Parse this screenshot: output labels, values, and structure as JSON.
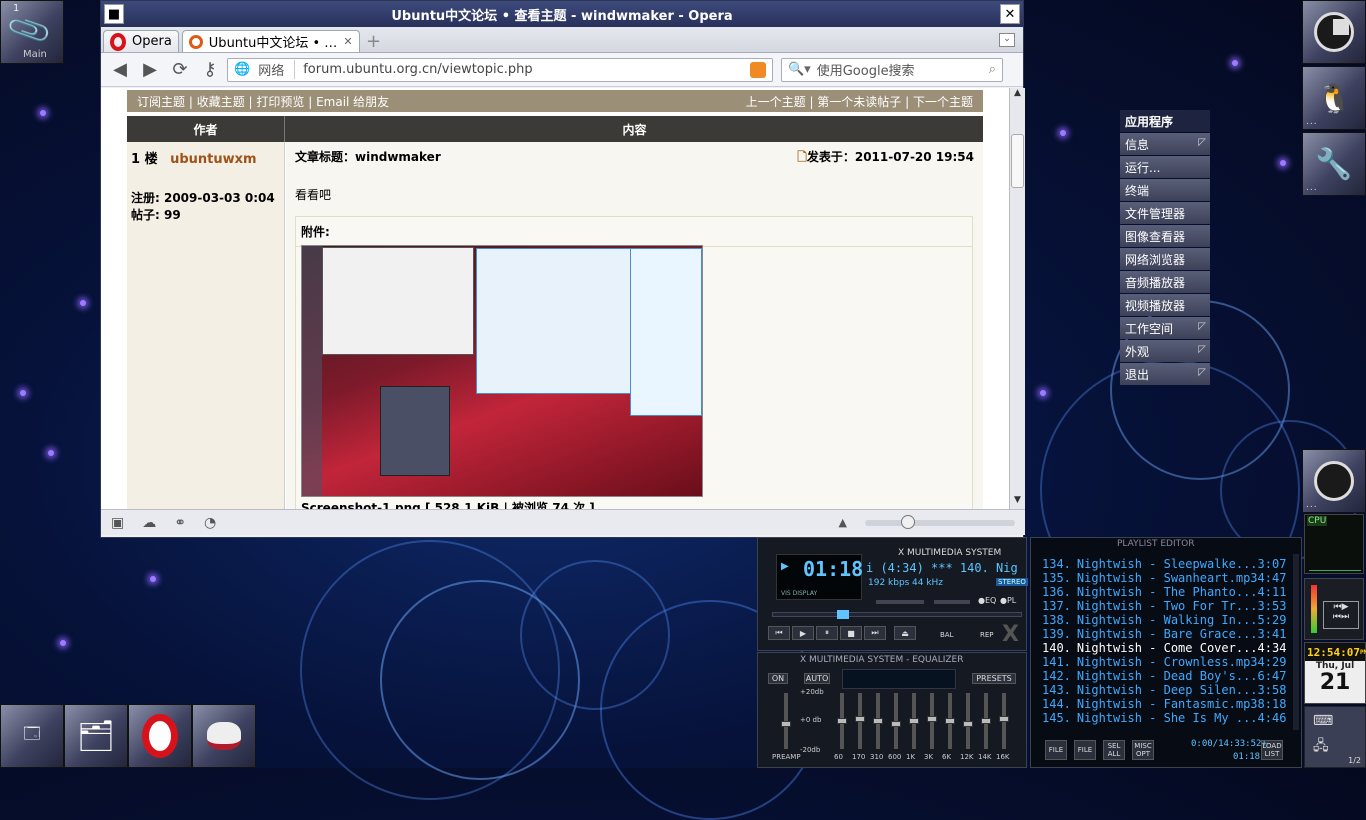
{
  "desktop": {
    "workspace_indicator": "1",
    "workspace_label": "Main"
  },
  "window": {
    "title": "Ubuntu中文论坛 • 查看主题 - windwmaker - Opera",
    "close_symbol": "✕",
    "menu_symbol": "■"
  },
  "tabs": {
    "opera_button": "Opera",
    "items": [
      {
        "label": "Ubuntu中文论坛 • …",
        "close": "✕"
      }
    ],
    "new_tab": "+"
  },
  "nav": {
    "back_icon": "back-arrow-icon",
    "site_label": "网络",
    "url": "forum.ubuntu.org.cn/viewtopic.php",
    "search_placeholder": "使用Google搜索"
  },
  "forum": {
    "left_links": [
      "订阅主题",
      "收藏主题",
      "打印预览",
      "Email 给朋友"
    ],
    "right_links": [
      "上一个主题",
      "第一个未读帖子",
      "下一个主题"
    ],
    "col_author": "作者",
    "col_content": "内容",
    "post": {
      "floor": "1 楼",
      "author": "ubuntuwxm",
      "registered": "注册: 2009-03-03 0:04",
      "posts": "帖子: 99",
      "subject": "文章标题：windwmaker",
      "posted_at": "发表于：2011-07-20 19:54",
      "body": "看看吧",
      "attachment_label": "附件:",
      "attachment_caption": "Screenshot-1.png [ 528.1 KiB | 被浏览 74 次 ]"
    }
  },
  "wm_menu": {
    "title": "应用程序",
    "items": [
      {
        "label": "信息",
        "sub": true
      },
      {
        "label": "运行...",
        "sub": false
      },
      {
        "label": "终端",
        "sub": false
      },
      {
        "label": "文件管理器",
        "sub": false
      },
      {
        "label": "图像查看器",
        "sub": false
      },
      {
        "label": "网络浏览器",
        "sub": false
      },
      {
        "label": "音频播放器",
        "sub": false
      },
      {
        "label": "视频播放器",
        "sub": false
      },
      {
        "label": "工作空间",
        "sub": true
      },
      {
        "label": "外观",
        "sub": true
      },
      {
        "label": "退出",
        "sub": true
      }
    ]
  },
  "xmms": {
    "player_title": "X MULTIMEDIA SYSTEM",
    "time": "01:18",
    "track_info": "i (4:34)  ***  140. Nig",
    "bitrate": "192 kbps",
    "samplerate": "44 kHz",
    "stereo": "STEREO",
    "eq_label": "EQ",
    "pl_label": "PL",
    "balance": "BAL",
    "rep": "REP",
    "vis_label": "VIS DISPLAY",
    "eq_title": "X MULTIMEDIA SYSTEM - EQUALIZER",
    "eq_on": "ON",
    "eq_auto": "AUTO",
    "eq_presets": "PRESETS",
    "eq_db": [
      "+20db",
      "+0 db",
      "-20db"
    ],
    "eq_preamp": "PREAMP",
    "eq_bands": [
      "60",
      "170",
      "310",
      "600",
      "1K",
      "3K",
      "6K",
      "12K",
      "14K",
      "16K"
    ],
    "playlist_title": "PLAYLIST EDITOR",
    "playlist": [
      {
        "n": "134.",
        "t": "Nightwish - Sleepwalke...",
        "d": "3:07"
      },
      {
        "n": "135.",
        "t": "Nightwish - Swanheart.mp3",
        "d": "4:47"
      },
      {
        "n": "136.",
        "t": "Nightwish - The Phanto...",
        "d": "4:11"
      },
      {
        "n": "137.",
        "t": "Nightwish - Two For Tr...",
        "d": "3:53"
      },
      {
        "n": "138.",
        "t": "Nightwish - Walking In...",
        "d": "5:29"
      },
      {
        "n": "139.",
        "t": "Nightwish - Bare Grace...",
        "d": "3:41"
      },
      {
        "n": "140.",
        "t": "Nightwish - Come Cover...",
        "d": "4:34"
      },
      {
        "n": "141.",
        "t": "Nightwish - Crownless.mp3",
        "d": "4:29"
      },
      {
        "n": "142.",
        "t": "Nightwish - Dead Boy's...",
        "d": "6:47"
      },
      {
        "n": "143.",
        "t": "Nightwish - Deep Silen...",
        "d": "3:58"
      },
      {
        "n": "144.",
        "t": "Nightwish - Fantasmic.mp3",
        "d": "8:18"
      },
      {
        "n": "145.",
        "t": "Nightwish - She Is My ...",
        "d": "4:46"
      }
    ],
    "current_index": 6,
    "pl_buttons": [
      "FILE",
      "FILE",
      "SEL ALL",
      "MISC OPT",
      "LOAD LIST"
    ],
    "pl_time": "0:00/14:33:52+",
    "pl_small_time": "01:18"
  },
  "dockapps": {
    "cpu_label": "CPU",
    "clock": "12:54:07",
    "clock_suffix": "PM",
    "day": "Thu, Jul",
    "date": "21",
    "pager": "1/2"
  },
  "colors": {
    "accent": "#28315a",
    "forum_bar": "#9c8f78",
    "playlist_text": "#3fa9ff"
  }
}
